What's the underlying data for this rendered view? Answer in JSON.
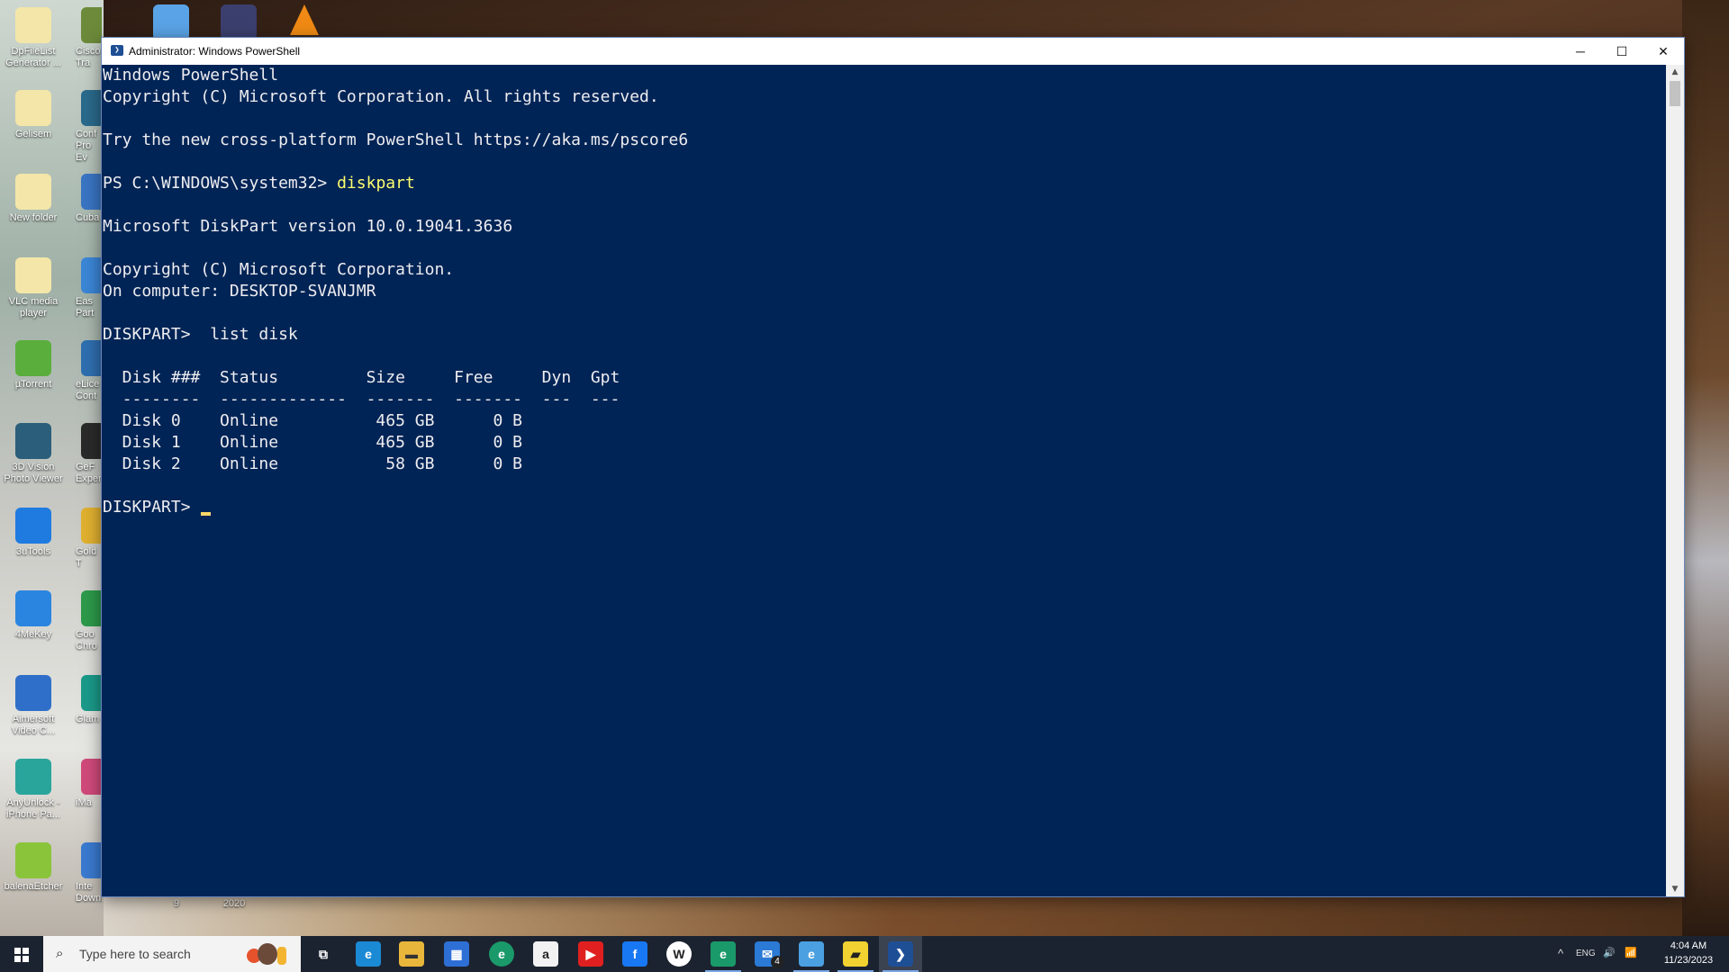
{
  "desktop": {
    "icons": [
      {
        "label": "DpFileList Generator ..."
      },
      {
        "label": "Gelisem"
      },
      {
        "label": "New folder"
      },
      {
        "label": "VLC media player"
      },
      {
        "label": "µTorrent"
      },
      {
        "label": "3D Vision Photo Viewer"
      },
      {
        "label": "3uTools"
      },
      {
        "label": "4MeKey"
      },
      {
        "label": "Aimersoft Video C..."
      },
      {
        "label": "AnyUnlock - iPhone Pa..."
      },
      {
        "label": "balenaEtcher"
      }
    ],
    "partial_labels": [
      "Cisco Tra",
      "Conf Pro Ev",
      "Cuba",
      "Eas Part",
      "eLice Cont",
      "GeF Exper",
      "Gold T",
      "Goo Chro",
      "Glam",
      "iMa",
      "Inte Downlo..."
    ],
    "bottom_labels": [
      "9",
      "2020"
    ]
  },
  "window": {
    "title": "Administrator: Windows PowerShell",
    "icon": "powershell-icon",
    "controls": {
      "minimize": "─",
      "maximize": "☐",
      "close": "✕"
    }
  },
  "console": {
    "lines": [
      {
        "text": "Windows PowerShell"
      },
      {
        "text": "Copyright (C) Microsoft Corporation. All rights reserved."
      },
      {
        "text": ""
      },
      {
        "text": "Try the new cross-platform PowerShell https://aka.ms/pscore6"
      },
      {
        "text": ""
      },
      {
        "prompt": "PS C:\\WINDOWS\\system32> ",
        "cmd": "diskpart"
      },
      {
        "text": ""
      },
      {
        "text": "Microsoft DiskPart version 10.0.19041.3636"
      },
      {
        "text": ""
      },
      {
        "text": "Copyright (C) Microsoft Corporation."
      },
      {
        "text": "On computer: DESKTOP-SVANJMR"
      },
      {
        "text": ""
      },
      {
        "text": "DISKPART>  list disk"
      },
      {
        "text": ""
      },
      {
        "text": "  Disk ###  Status         Size     Free     Dyn  Gpt"
      },
      {
        "text": "  --------  -------------  -------  -------  ---  ---"
      },
      {
        "text": "  Disk 0    Online          465 GB      0 B"
      },
      {
        "text": "  Disk 1    Online          465 GB      0 B"
      },
      {
        "text": "  Disk 2    Online           58 GB      0 B"
      },
      {
        "text": ""
      }
    ],
    "current_prompt": "DISKPART> ",
    "colors": {
      "background": "#012456",
      "text": "#eeedf0",
      "command": "#fdfd6e"
    }
  },
  "taskbar": {
    "search_placeholder": "Type here to search",
    "apps": [
      {
        "name": "task-view-icon",
        "glyph": "⧉"
      },
      {
        "name": "edge-icon",
        "glyph": "e"
      },
      {
        "name": "file-explorer-icon",
        "glyph": "▬"
      },
      {
        "name": "microsoft-store-icon",
        "glyph": "▦"
      },
      {
        "name": "edge-dev-icon",
        "glyph": "e"
      },
      {
        "name": "amazon-icon",
        "glyph": "a"
      },
      {
        "name": "youtube-icon",
        "glyph": "▶"
      },
      {
        "name": "facebook-icon",
        "glyph": "f"
      },
      {
        "name": "wikipedia-icon",
        "glyph": "W"
      },
      {
        "name": "edge-beta-icon",
        "glyph": "e"
      },
      {
        "name": "mail-icon",
        "glyph": "✉"
      },
      {
        "name": "internet-explorer-icon",
        "glyph": "e"
      },
      {
        "name": "sticky-notes-icon",
        "glyph": "▰"
      },
      {
        "name": "powershell-taskbar-icon",
        "glyph": "❯"
      }
    ],
    "mail_badge": "4",
    "tray": {
      "chevron": "^",
      "ime": "ENG",
      "volume": "🔊",
      "network": "📶"
    },
    "time": "4:04 AM",
    "date": "11/23/2023"
  }
}
